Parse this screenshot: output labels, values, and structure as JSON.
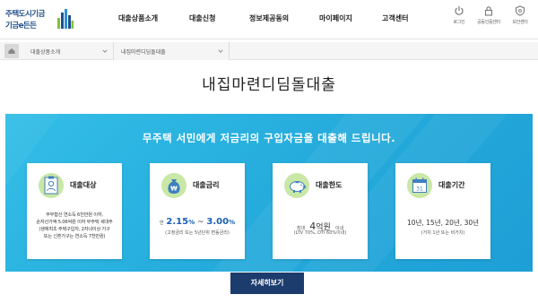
{
  "header": {
    "logo_line1": "주택도시기금",
    "logo_line2": "기금e든든",
    "nav": [
      {
        "label": "대출상품소개"
      },
      {
        "label": "대출신청"
      },
      {
        "label": "정보제공동의"
      },
      {
        "label": "마이페이지"
      },
      {
        "label": "고객센터"
      }
    ],
    "utils": [
      {
        "label": "로그인",
        "icon": "power-icon"
      },
      {
        "label": "공동인증센터",
        "icon": "lock-icon"
      },
      {
        "label": "보안센터",
        "icon": "shield-icon"
      }
    ]
  },
  "breadcrumb": {
    "level1": "대출상품소개",
    "level2": "내집마련디딤돌대출"
  },
  "page_title": "내집마련디딤돌대출",
  "banner": {
    "headline": "무주택 서민에게 저금리의 구입자금을 대출해 드립니다.",
    "cards": {
      "target": {
        "title": "대출대상",
        "lines": [
          "부부합산 연소득 6천만원 이하,",
          "순자산가액 5.06억원 이하 무주택 세대주",
          "(생애최초 주택구입자, 2자녀이상 가구",
          "또는 신혼가구는 연소득 7천만원)"
        ]
      },
      "rate": {
        "title": "대출금리",
        "prefix": "연",
        "min": "2.15",
        "max": "3.00",
        "unit": "%",
        "sep": "~",
        "note": "(고정금리 또는 5년단위 변동금리)"
      },
      "limit": {
        "title": "대출한도",
        "prefix": "최대",
        "amount": "4",
        "unit": "억원",
        "suffix": "이내",
        "note": "(LTV 70%, DTI 60%이내)"
      },
      "period": {
        "title": "대출기간",
        "calendar_day": "31",
        "value": "10년, 15년, 20년, 30년",
        "note": "(거치 1년 또는 비거치)"
      }
    }
  },
  "detail_button": "자세히보기",
  "colors": {
    "banner": "#24aadb",
    "navy": "#1d3c6e",
    "accent_blue": "#1a5fb4",
    "icon_green": "#c9e7a6"
  }
}
